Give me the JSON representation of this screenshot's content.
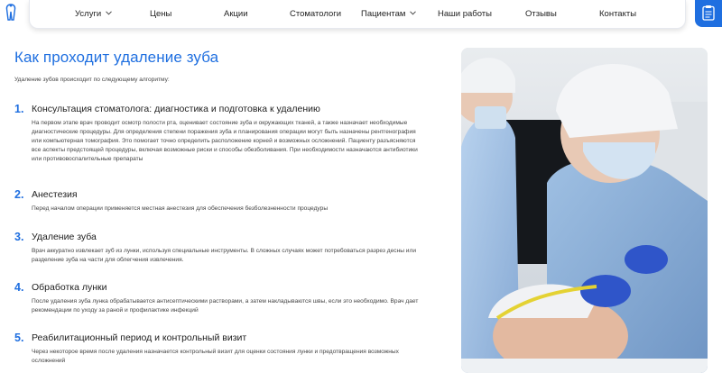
{
  "nav": {
    "items": [
      {
        "label": "Услуги",
        "dropdown": true
      },
      {
        "label": "Цены",
        "dropdown": false
      },
      {
        "label": "Акции",
        "dropdown": false
      },
      {
        "label": "Стоматологи",
        "dropdown": false
      },
      {
        "label": "Пациентам",
        "dropdown": true
      },
      {
        "label": "Наши работы",
        "dropdown": false
      },
      {
        "label": "Отзывы",
        "dropdown": false
      },
      {
        "label": "Контакты",
        "dropdown": false
      }
    ]
  },
  "colors": {
    "accent": "#1f6fe0"
  },
  "icons": {
    "logo": "tooth-logo-icon",
    "corner": "clipboard-icon",
    "dropdown": "chevron-down-icon"
  },
  "page": {
    "title": "Как проходит удаление зуба",
    "intro": "Удаление зубов происходит по следующему алгоритму:"
  },
  "steps": [
    {
      "number": "1.",
      "heading": "Консультация стоматолога: диагностика и подготовка к удалению",
      "body": "На первом этапе врач проводит осмотр полости рта, оценивает состояние зуба и окружающих тканей, а также назначает необходимые диагностические процедуры. Для определения степени поражения зуба и планирования операции могут быть назначены рентгенография или компьютерная томография. Это помогает точно определить расположение корней и возможных осложнений. Пациенту разъясняются все аспекты предстоящей процедуры, включая возможные риски и способы обезболивания. При необходимости назначаются антибиотики или противовоспалительные препараты"
    },
    {
      "number": "2.",
      "heading": "Анестезия",
      "body": "Перед началом операции применяется местная анестезия для обеспечения безболезненности процедуры"
    },
    {
      "number": "3.",
      "heading": "Удаление зуба",
      "body": "Врач аккуратно извлекает зуб из лунки, используя специальные инструменты. В сложных случаях может потребоваться разрез десны или разделение зуба на части для облегчения извлечения."
    },
    {
      "number": "4.",
      "heading": "Обработка лунки",
      "body": "После удаления зуба лунка обрабатывается антисептическими растворами, а затем накладываются швы, если это необходимо. Врач дает рекомендации по уходу за раной и профилактике инфекций"
    },
    {
      "number": "5.",
      "heading": "Реабилитационный период и контрольный визит",
      "body": "Через некоторое время после удаления назначается контрольный визит для оценки состояния лунки и предотвращения возможных осложнений"
    }
  ]
}
